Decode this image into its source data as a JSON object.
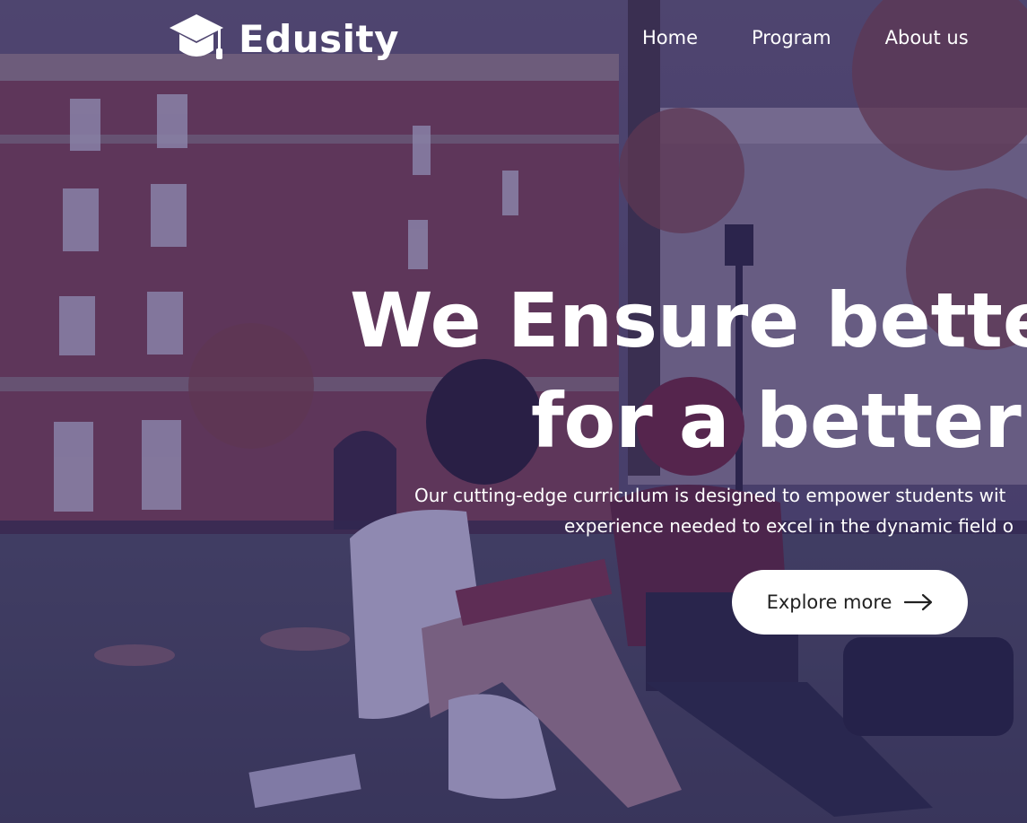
{
  "brand": {
    "name": "Edusity",
    "icon": "graduation-cap-icon"
  },
  "nav": {
    "items": [
      "Home",
      "Program",
      "About us"
    ]
  },
  "hero": {
    "headline_line1": "We Ensure better e",
    "headline_line2": "for a better w",
    "sub_line1": "Our cutting-edge curriculum is designed to empower students wit",
    "sub_line2": "experience needed to excel in the dynamic field o",
    "cta_label": "Explore more",
    "cta_icon": "arrow-right-icon"
  },
  "colors": {
    "overlay": "#281e6e",
    "text": "#ffffff",
    "button_bg": "#ffffff",
    "button_text": "#212121"
  }
}
